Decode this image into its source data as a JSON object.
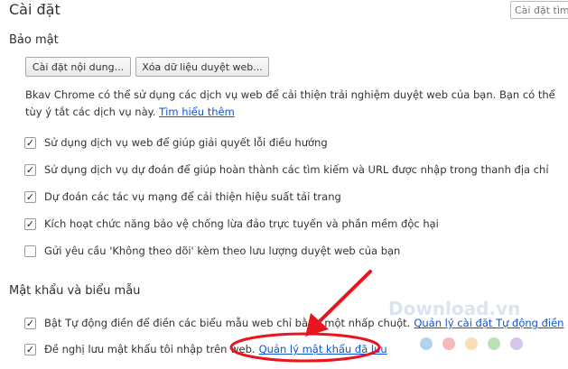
{
  "header": {
    "title": "Cài đặt",
    "search_placeholder": "Cài đặt tìm"
  },
  "security": {
    "section_title": "Bảo mật",
    "content_settings_button": "Cài đặt nội dung...",
    "clear_data_button": "Xóa dữ liệu duyệt web...",
    "description": "Bkav Chrome có thể sử dụng các dịch vụ web để cải thiện trải nghiệm duyệt web của bạn. Bạn có thể tùy ý tắt các dịch vụ này.",
    "learn_more_link": "Tìm hiểu thêm",
    "options": [
      {
        "label": "Sử dụng dịch vụ web để giúp giải quyết lỗi điều hướng",
        "checked": true
      },
      {
        "label": "Sử dụng dịch vụ dự đoán để giúp hoàn thành các tìm kiếm và URL được nhập trong thanh địa chỉ",
        "checked": true
      },
      {
        "label": "Dự đoán các tác vụ mạng để cải thiện hiệu suất tải trang",
        "checked": true
      },
      {
        "label": "Kích hoạt chức năng bảo vệ chống lừa đảo trực tuyến và phần mềm độc hại",
        "checked": true
      },
      {
        "label": "Gửi yêu cầu 'Không theo dõi' kèm theo lưu lượng duyệt web của bạn",
        "checked": false
      }
    ]
  },
  "passwords": {
    "section_title": "Mật khẩu và biểu mẫu",
    "autofill": {
      "label": "Bật Tự động điền để điền các biểu mẫu web chỉ bằng một nhấp chuột.",
      "link": "Quản lý cài đặt Tự động điền",
      "checked": true
    },
    "save_passwords": {
      "label": "Đề nghị lưu mật khẩu tôi nhập trên web.",
      "link": "Quản lý mật khẩu đã lưu",
      "checked": true
    }
  },
  "annotation": {
    "arrow_color": "#e8141e",
    "highlight_color": "#e8141e"
  },
  "watermark": {
    "text": "Download.vn",
    "dot_colors": [
      "#9dc9ea",
      "#f4a8a8",
      "#f7d6a0",
      "#a9dba5",
      "#c9b6e4"
    ]
  }
}
